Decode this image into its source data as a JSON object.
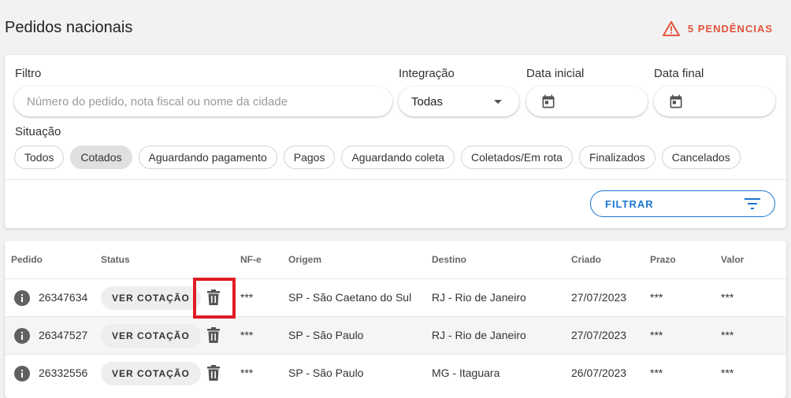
{
  "page_title": "Pedidos nacionais",
  "pendencias": "5 PENDÊNCIAS",
  "filters": {
    "filtro_label": "Filtro",
    "filtro_placeholder": "Número do pedido, nota fiscal ou nome da cidade",
    "integracao_label": "Integração",
    "integracao_value": "Todas",
    "data_inicial_label": "Data inicial",
    "data_final_label": "Data final",
    "situacao_label": "Situação",
    "chips": [
      "Todos",
      "Cotados",
      "Aguardando pagamento",
      "Pagos",
      "Aguardando coleta",
      "Coletados/Em rota",
      "Finalizados",
      "Cancelados"
    ],
    "selected_chip": "Cotados",
    "filtrar_label": "FILTRAR"
  },
  "table": {
    "headers": [
      "Pedido",
      "Status",
      "NF-e",
      "Origem",
      "Destino",
      "Criado",
      "Prazo",
      "Valor"
    ],
    "rows": [
      {
        "pedido": "26347634",
        "status": "VER COTAÇÃO",
        "nfe": "***",
        "origem": "SP - São Caetano do Sul",
        "destino": "RJ - Rio de Janeiro",
        "criado": "27/07/2023",
        "prazo": "***",
        "valor": "***"
      },
      {
        "pedido": "26347527",
        "status": "VER COTAÇÃO",
        "nfe": "***",
        "origem": "SP - São Paulo",
        "destino": "RJ - Rio de Janeiro",
        "criado": "27/07/2023",
        "prazo": "***",
        "valor": "***"
      },
      {
        "pedido": "26332556",
        "status": "VER COTAÇÃO",
        "nfe": "***",
        "origem": "SP - São Paulo",
        "destino": "MG - Itaguara",
        "criado": "26/07/2023",
        "prazo": "***",
        "valor": "***"
      }
    ]
  },
  "colors": {
    "warning": "#e2533c",
    "primary": "#1976d2",
    "highlight": "#e01b24"
  },
  "icons": {
    "warning": "warning-triangle-icon",
    "calendar": "calendar-icon",
    "filter": "filter-lines-icon",
    "info": "info-icon",
    "trash": "trash-icon"
  }
}
